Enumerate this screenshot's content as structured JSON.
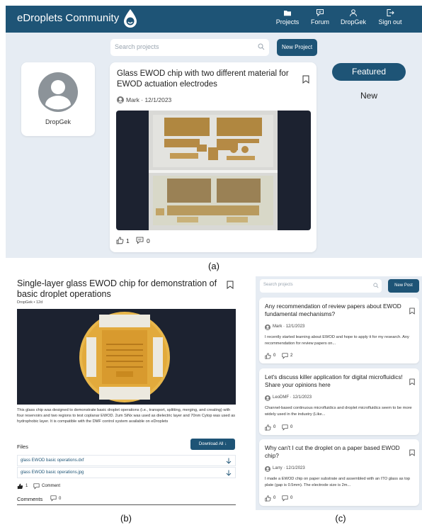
{
  "panel_a": {
    "caption": "(a)",
    "nav": {
      "brand": "eDroplets Community",
      "items": [
        {
          "label": "Projects",
          "icon": "folder-icon"
        },
        {
          "label": "Forum",
          "icon": "chat-icon"
        },
        {
          "label": "DropGek",
          "icon": "user-icon"
        },
        {
          "label": "Sign out",
          "icon": "sign-out-icon"
        }
      ]
    },
    "search": {
      "placeholder": "Search projects"
    },
    "new_project_label": "New Project",
    "profile": {
      "name": "DropGek"
    },
    "card": {
      "title": "Glass EWOD chip with two different material for EWOD actuation electrodes",
      "author": "Mark",
      "date": "12/1/2023",
      "likes": "1",
      "comments": "0"
    },
    "tabs": {
      "featured": "Featured",
      "new": "New"
    }
  },
  "panel_b": {
    "caption": "(b)",
    "title": "Single-layer glass EWOD chip for demonstration of basic droplet operations",
    "author": "DropGek",
    "age": "12d",
    "description": "This glass chip was designed to demonstrate basic droplet operations (i.e., transport, splitting, merging, and creating) with four reservoirs and two regions to test coplanar EWOD. 2um SiNx was used as dielectric layer and 70nm Cytop was used as hydrophobic layer. It is compatible with the DMF control system available on eDroplets",
    "files_label": "Files",
    "download_all_label": "Download All",
    "files": [
      "glass EWOD basic operations.dxf",
      "glass EWOD basic operations.jpg"
    ],
    "likes": "1",
    "comment_label": "Comment",
    "comments_label": "Comments",
    "comments_count": "0"
  },
  "panel_c": {
    "caption": "(c)",
    "search": {
      "placeholder": "Search projects"
    },
    "new_post_label": "New Post",
    "posts": [
      {
        "title": "Any recommendation of review papers about EWOD fundamental mechanisms?",
        "author": "Mark",
        "date": "12/1/2023",
        "excerpt": "I recently started learning about EWOD and hope to apply it for my research. Any recommendation for review papers on...",
        "likes": "0",
        "comments": "2"
      },
      {
        "title": "Let's discuss killer application for digital microfluidics! Share your opinions here",
        "author": "LeoDMF",
        "date": "12/1/2023",
        "excerpt": "Channel-based continuous microfluidics and droplet microfluidics seem to be more widely used in the industry (Like...",
        "likes": "0",
        "comments": "0"
      },
      {
        "title": "Why can't I cut the droplet on a paper based EWOD chip?",
        "author": "Larry",
        "date": "12/1/2023",
        "excerpt": "I made a EWOD chip on paper substrate and assembled with an ITO glass as top plate (gap is 0.5mm). The electrode size is 2m...",
        "likes": "0",
        "comments": "0"
      }
    ]
  },
  "colors": {
    "primary": "#1e5476",
    "panel_bg": "#e6ecf3",
    "chip_yellow": "#e8b64a"
  }
}
